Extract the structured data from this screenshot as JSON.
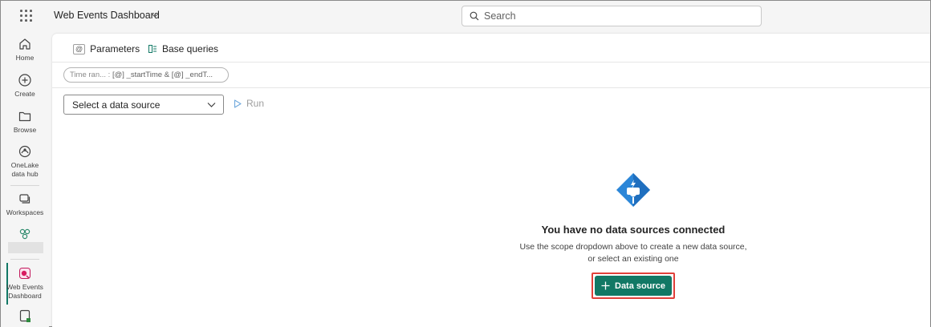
{
  "topbar": {
    "app_title": "Web Events Dashboard",
    "search_placeholder": "Search"
  },
  "rail": {
    "home": "Home",
    "create": "Create",
    "browse": "Browse",
    "onelake_line1": "OneLake",
    "onelake_line2": "data hub",
    "workspaces": "Workspaces",
    "active_line1": "Web Events",
    "active_line2": "Dashboard"
  },
  "toolbar": {
    "parameters": "Parameters",
    "base_queries": "Base queries"
  },
  "chip": {
    "label": "Time ran...",
    "sep": " : ",
    "start": "[@] _startTime",
    "amp": "  &  ",
    "end": "[@] _endT..."
  },
  "query": {
    "select_placeholder": "Select a data source",
    "run": "Run"
  },
  "empty": {
    "title": "You have no data sources connected",
    "description": "Use the scope dropdown above to create a new data source, or select an existing one",
    "button": "Data source"
  },
  "colors": {
    "accent": "#117865",
    "highlight": "#e0403a",
    "icon_blue": "#2b86d8"
  }
}
